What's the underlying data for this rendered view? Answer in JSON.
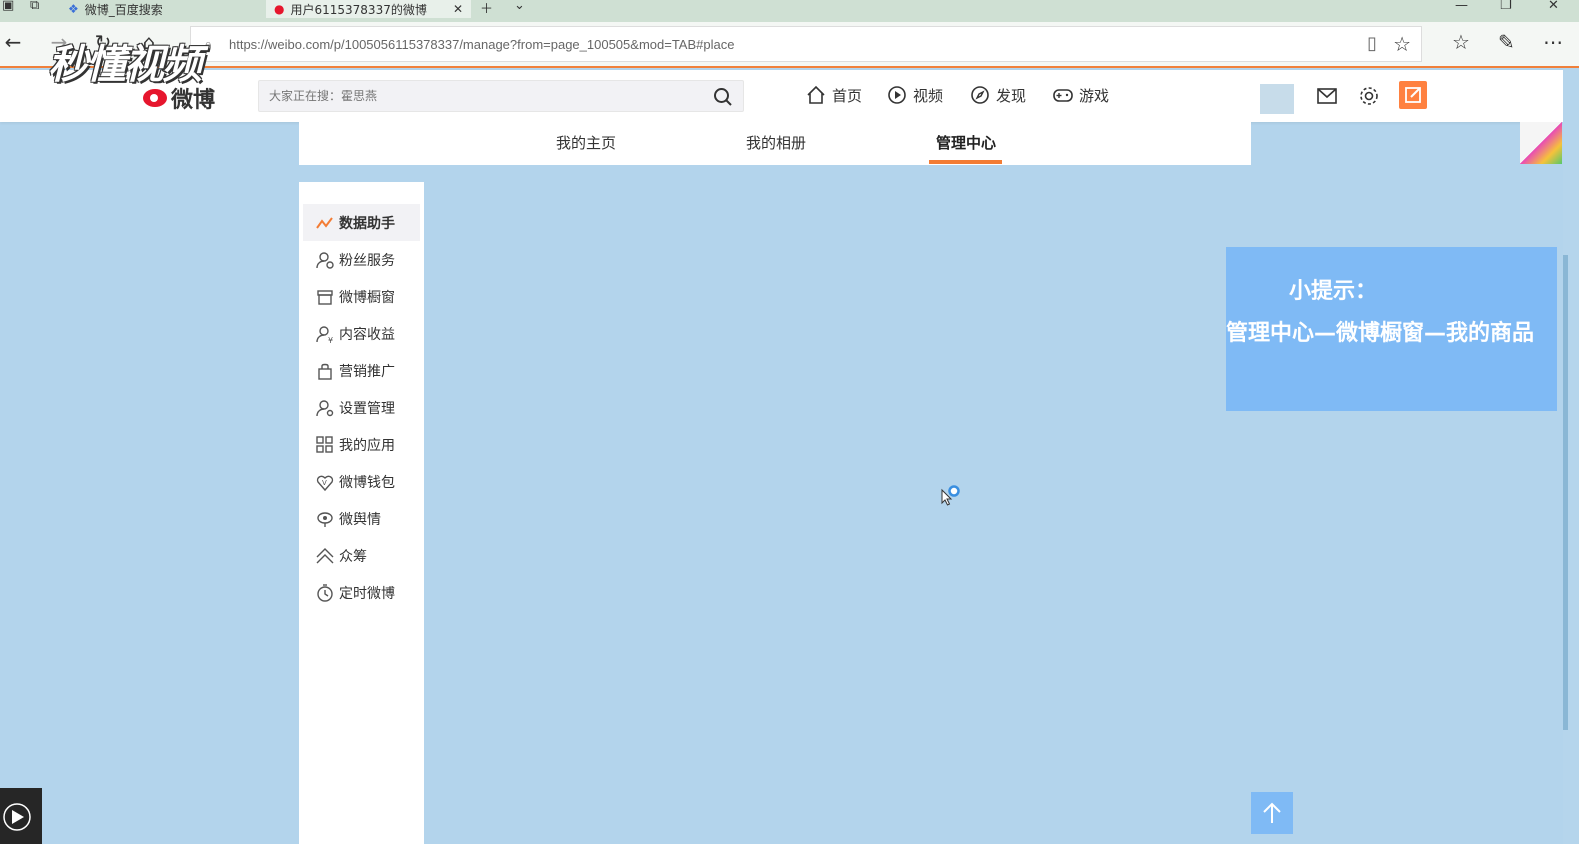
{
  "browser": {
    "tabs": [
      {
        "label": "微博_百度搜索",
        "active": false
      },
      {
        "label": "用户6115378337的微博",
        "active": true
      }
    ],
    "url": "https://weibo.com/p/1005056115378337/manage?from=page_100505&mod=TAB#place"
  },
  "watermark": "秒懂视频",
  "header": {
    "logo_text": "微博",
    "search_placeholder": "大家正在搜：霍思燕",
    "nav": [
      {
        "label": "首页",
        "icon": "home-icon"
      },
      {
        "label": "视频",
        "icon": "video-icon"
      },
      {
        "label": "发现",
        "icon": "discover-icon"
      },
      {
        "label": "游戏",
        "icon": "game-icon"
      }
    ]
  },
  "subtabs": [
    {
      "label": "我的主页",
      "active": false
    },
    {
      "label": "我的相册",
      "active": false
    },
    {
      "label": "管理中心",
      "active": true
    }
  ],
  "sidebar": {
    "items": [
      {
        "label": "数据助手",
        "icon": "chart-icon",
        "active": true
      },
      {
        "label": "粉丝服务",
        "icon": "fans-icon",
        "active": false
      },
      {
        "label": "微博橱窗",
        "icon": "shop-icon",
        "active": false
      },
      {
        "label": "内容收益",
        "icon": "income-icon",
        "active": false
      },
      {
        "label": "营销推广",
        "icon": "bag-icon",
        "active": false
      },
      {
        "label": "设置管理",
        "icon": "user-settings-icon",
        "active": false
      },
      {
        "label": "我的应用",
        "icon": "apps-grid-icon",
        "active": false
      },
      {
        "label": "微博钱包",
        "icon": "wallet-icon",
        "active": false
      },
      {
        "label": "微舆情",
        "icon": "eye-icon",
        "active": false
      },
      {
        "label": "众筹",
        "icon": "crowdfund-icon",
        "active": false
      },
      {
        "label": "定时微博",
        "icon": "timer-icon",
        "active": false
      }
    ]
  },
  "tip": {
    "title": "小提示：",
    "body": "管理中心—微博橱窗—我的商品"
  },
  "colors": {
    "accent_orange": "#f37c34",
    "tip_blue": "#7fbaf5",
    "background": "#b3d4ec"
  }
}
